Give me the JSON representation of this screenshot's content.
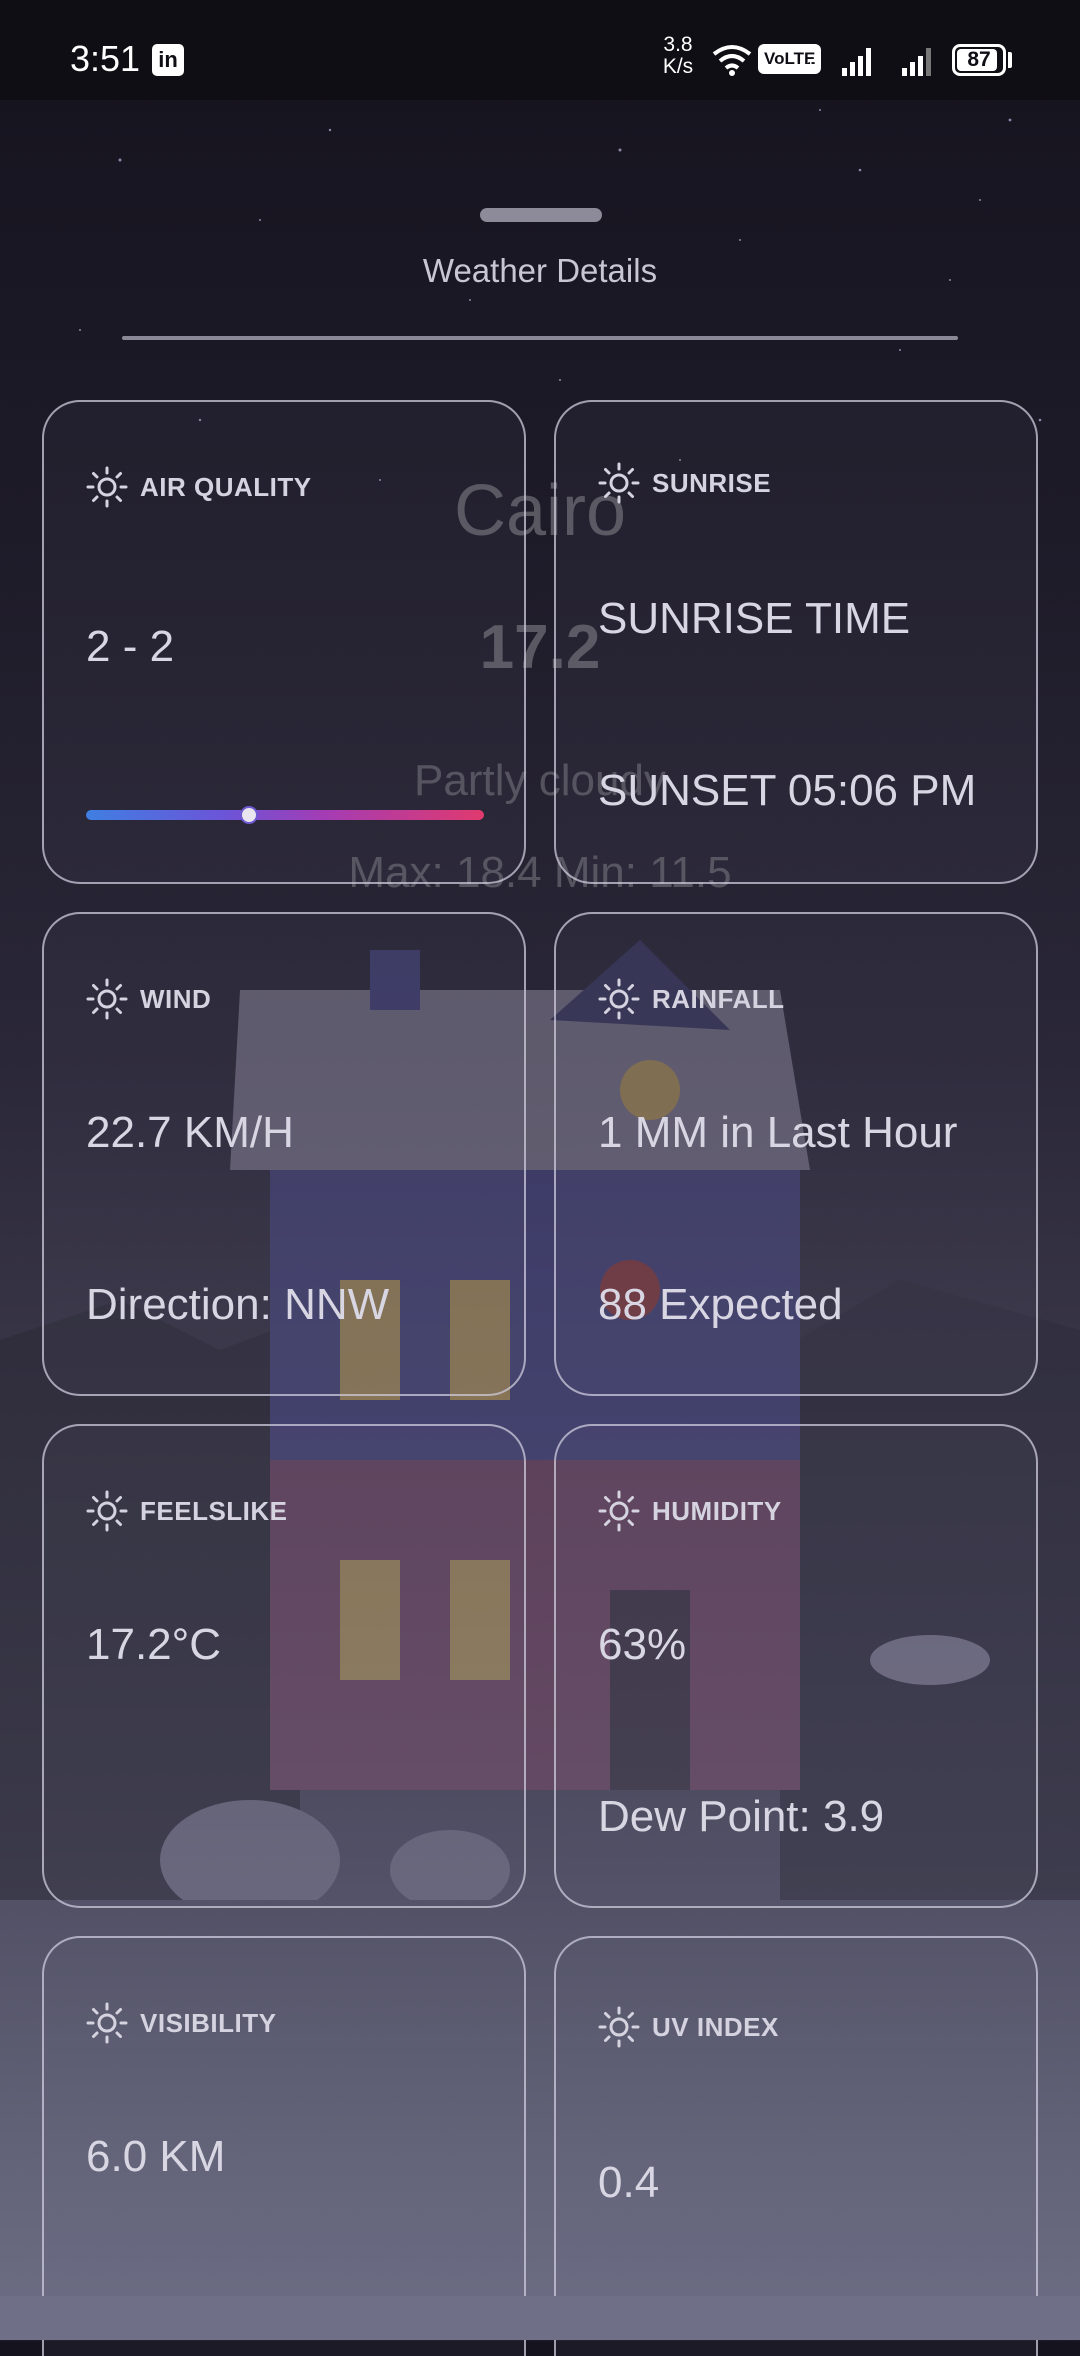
{
  "status_bar": {
    "time": "3:51",
    "net_speed_value": "3.8",
    "net_speed_unit": "K/s",
    "volte": "VoLTE",
    "volte_sub": "1",
    "battery": "87"
  },
  "background": {
    "city": "Cairo",
    "temperature": "17.2",
    "condition": "Partly cloudy",
    "max_min": "Max: 18.4  Min: 11.5"
  },
  "sheet": {
    "title": "Weather Details"
  },
  "cards": {
    "air_quality": {
      "label": "AIR QUALITY",
      "value": "2 - 2",
      "bar_position": 0.41
    },
    "sunrise": {
      "label": "SUNRISE",
      "line1": "SUNRISE TIME",
      "line2": "SUNSET 05:06 PM"
    },
    "wind": {
      "label": "WIND",
      "line1": "22.7 KM/H",
      "line2": "Direction: NNW"
    },
    "rainfall": {
      "label": "RAINFALL",
      "line1": "1 MM in Last Hour",
      "line2": "88 Expected"
    },
    "feelslike": {
      "label": "FEELSLIKE",
      "line1": "17.2°C"
    },
    "humidity": {
      "label": "HUMIDITY",
      "line1": "63%",
      "line2": "Dew Point: 3.9"
    },
    "visibility": {
      "label": "VISIBILITY",
      "line1": "6.0 KM"
    },
    "uv_index": {
      "label": "UV INDEX",
      "line1": "0.4"
    }
  },
  "icons": {
    "card_icon": "sun-icon"
  }
}
